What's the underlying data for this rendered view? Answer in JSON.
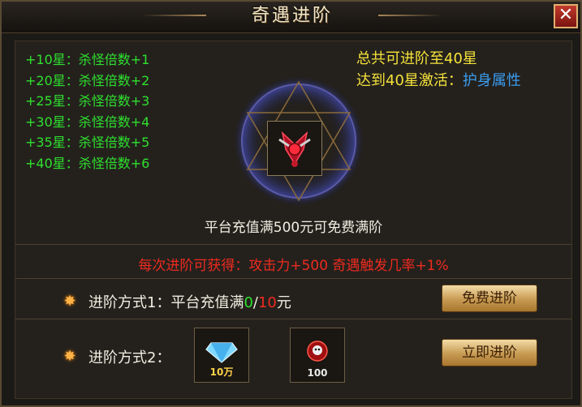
{
  "window": {
    "title": "奇遇进阶",
    "close_label": "✕"
  },
  "bonuses": [
    "+10星：杀怪倍数+1",
    "+20星：杀怪倍数+2",
    "+25星：杀怪倍数+3",
    "+30星：杀怪倍数+4",
    "+35星：杀怪倍数+5",
    "+40星：杀怪倍数+6"
  ],
  "summary": {
    "max_text": "总共可进阶至40星",
    "activate_text": "达到40星激活：",
    "activate_link": "护身属性"
  },
  "note": "平台充值满500元可免费满阶",
  "reward_text": "每次进阶可获得：攻击力+500 奇遇触发几率+1%",
  "method1": {
    "label": "进阶方式1：",
    "desc": "平台充值满",
    "current": "0",
    "slash": "/",
    "target": "10",
    "unit": "元",
    "button": "免费进阶"
  },
  "method2": {
    "label": "进阶方式2：",
    "cost1_qty": "10万",
    "cost2_qty": "100",
    "button": "立即进阶"
  },
  "colors": {
    "green": "#2ee02e",
    "yellow": "#f5e23a",
    "red": "#ee2a1f",
    "link": "#3a9cf0"
  }
}
